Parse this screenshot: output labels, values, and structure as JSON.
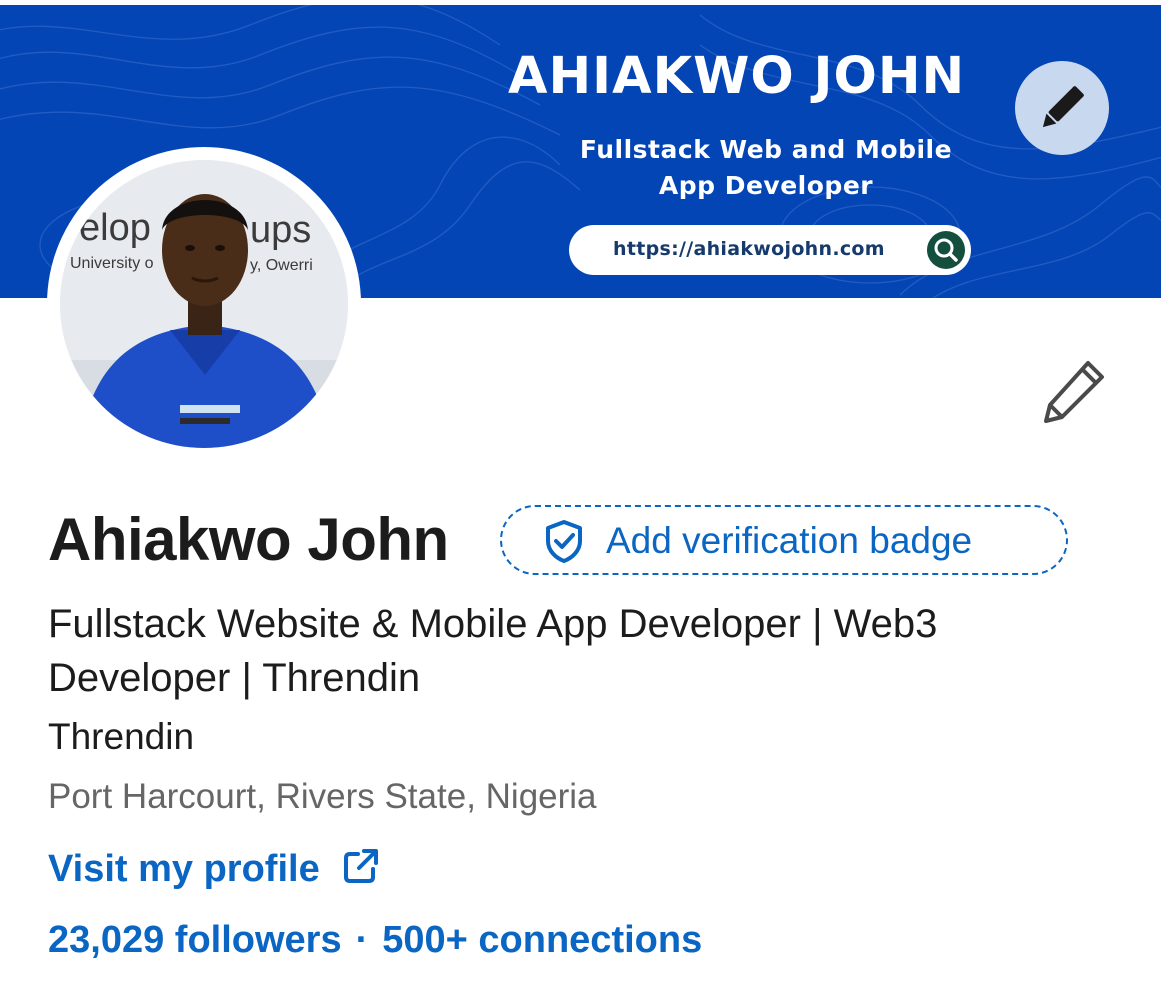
{
  "banner": {
    "title": "AHIAKWO JOHN",
    "subtitle_line1": "Fullstack Web and Mobile",
    "subtitle_line2": "App Developer",
    "url": "https://ahiakwojohn.com",
    "background_color": "#0445b5"
  },
  "avatar_text": {
    "line1": "velop",
    "line1b": "ups",
    "line2": "University o",
    "line2b": "y, Owerri"
  },
  "profile": {
    "name": "Ahiakwo John",
    "verification_label": "Add verification badge",
    "headline": "Fullstack Website & Mobile App Developer | Web3 Developer | Threndin",
    "company": "Threndin",
    "location": "Port Harcourt, Rivers State, Nigeria",
    "visit_label": "Visit my profile",
    "followers": "23,029 followers",
    "separator": "·",
    "connections": "500+ connections"
  },
  "icons": {
    "banner_edit": "pencil-icon",
    "profile_edit": "pencil-icon",
    "verification": "shield-check-icon",
    "visit": "external-link-icon",
    "url_search": "search-icon"
  },
  "colors": {
    "accent": "#0a66c2",
    "text": "#1c1c1c",
    "muted": "#666666"
  }
}
